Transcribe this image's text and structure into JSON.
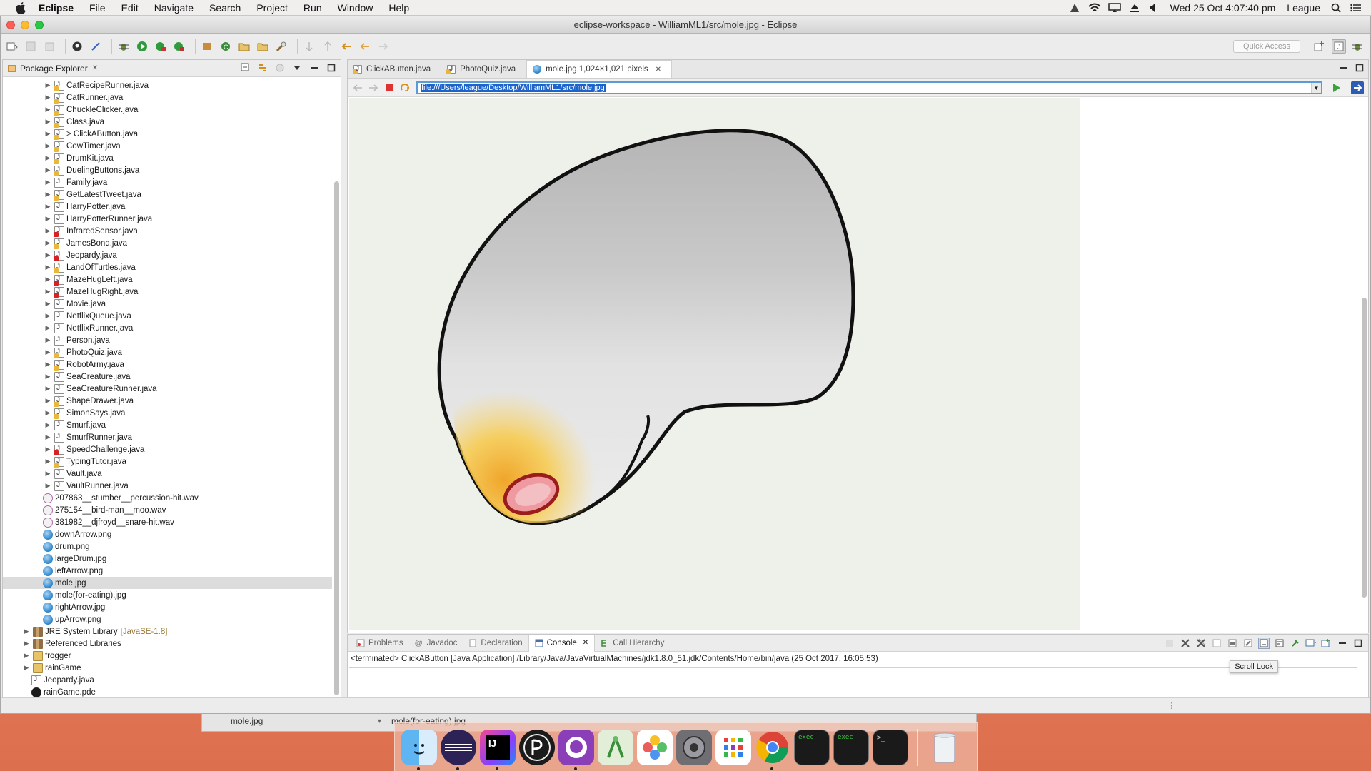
{
  "menubar": {
    "app_name": "Eclipse",
    "menus": [
      "File",
      "Edit",
      "Navigate",
      "Search",
      "Project",
      "Run",
      "Window",
      "Help"
    ],
    "clock": "Wed 25 Oct  4:07:40 pm",
    "user": "League"
  },
  "window": {
    "title": "eclipse-workspace - WilliamML1/src/mole.jpg - Eclipse",
    "quick_access_placeholder": "Quick Access"
  },
  "package_explorer": {
    "title": "Package Explorer",
    "items": [
      {
        "label": "CatRecipeRunner.java",
        "kind": "java",
        "badge": "warn",
        "indent": 1
      },
      {
        "label": "CatRunner.java",
        "kind": "java",
        "badge": "warn",
        "indent": 1
      },
      {
        "label": "ChuckleClicker.java",
        "kind": "java",
        "badge": "warn",
        "indent": 1
      },
      {
        "label": "Class.java",
        "kind": "java",
        "badge": "warn",
        "indent": 1
      },
      {
        "label": "> ClickAButton.java",
        "kind": "java",
        "badge": "warn",
        "indent": 1
      },
      {
        "label": "CowTimer.java",
        "kind": "java",
        "badge": "warn",
        "indent": 1
      },
      {
        "label": "DrumKit.java",
        "kind": "java",
        "badge": "warn",
        "indent": 1
      },
      {
        "label": "DuelingButtons.java",
        "kind": "java",
        "badge": "warn",
        "indent": 1
      },
      {
        "label": "Family.java",
        "kind": "java",
        "badge": "none",
        "indent": 1
      },
      {
        "label": "GetLatestTweet.java",
        "kind": "java",
        "badge": "warn",
        "indent": 1
      },
      {
        "label": "HarryPotter.java",
        "kind": "java",
        "badge": "none",
        "indent": 1
      },
      {
        "label": "HarryPotterRunner.java",
        "kind": "java",
        "badge": "none",
        "indent": 1
      },
      {
        "label": "InfraredSensor.java",
        "kind": "java",
        "badge": "err",
        "indent": 1
      },
      {
        "label": "JamesBond.java",
        "kind": "java",
        "badge": "warn",
        "indent": 1
      },
      {
        "label": "Jeopardy.java",
        "kind": "java",
        "badge": "err",
        "indent": 1
      },
      {
        "label": "LandOfTurtles.java",
        "kind": "java",
        "badge": "warn",
        "indent": 1
      },
      {
        "label": "MazeHugLeft.java",
        "kind": "java",
        "badge": "err",
        "indent": 1
      },
      {
        "label": "MazeHugRight.java",
        "kind": "java",
        "badge": "err",
        "indent": 1
      },
      {
        "label": "Movie.java",
        "kind": "java",
        "badge": "none",
        "indent": 1
      },
      {
        "label": "NetflixQueue.java",
        "kind": "java",
        "badge": "none",
        "indent": 1
      },
      {
        "label": "NetflixRunner.java",
        "kind": "java",
        "badge": "none",
        "indent": 1
      },
      {
        "label": "Person.java",
        "kind": "java",
        "badge": "none",
        "indent": 1
      },
      {
        "label": "PhotoQuiz.java",
        "kind": "java",
        "badge": "warn",
        "indent": 1
      },
      {
        "label": "RobotArmy.java",
        "kind": "java",
        "badge": "warn",
        "indent": 1
      },
      {
        "label": "SeaCreature.java",
        "kind": "java",
        "badge": "none",
        "indent": 1
      },
      {
        "label": "SeaCreatureRunner.java",
        "kind": "java",
        "badge": "none",
        "indent": 1
      },
      {
        "label": "ShapeDrawer.java",
        "kind": "java",
        "badge": "warn",
        "indent": 1
      },
      {
        "label": "SimonSays.java",
        "kind": "java",
        "badge": "warn",
        "indent": 1
      },
      {
        "label": "Smurf.java",
        "kind": "java",
        "badge": "none",
        "indent": 1
      },
      {
        "label": "SmurfRunner.java",
        "kind": "java",
        "badge": "none",
        "indent": 1
      },
      {
        "label": "SpeedChallenge.java",
        "kind": "java",
        "badge": "err",
        "indent": 1
      },
      {
        "label": "TypingTutor.java",
        "kind": "java",
        "badge": "warn",
        "indent": 1
      },
      {
        "label": "Vault.java",
        "kind": "java",
        "badge": "none",
        "indent": 1
      },
      {
        "label": "VaultRunner.java",
        "kind": "java",
        "badge": "none",
        "indent": 1
      },
      {
        "label": "207863__stumber__percussion-hit.wav",
        "kind": "wav",
        "indent": 0
      },
      {
        "label": "275154__bird-man__moo.wav",
        "kind": "wav",
        "indent": 0
      },
      {
        "label": "381982__djfroyd__snare-hit.wav",
        "kind": "wav",
        "indent": 0
      },
      {
        "label": "downArrow.png",
        "kind": "img",
        "indent": 0
      },
      {
        "label": "drum.png",
        "kind": "img",
        "indent": 0
      },
      {
        "label": "largeDrum.jpg",
        "kind": "img",
        "indent": 0
      },
      {
        "label": "leftArrow.png",
        "kind": "img",
        "indent": 0
      },
      {
        "label": "mole.jpg",
        "kind": "img",
        "indent": 0,
        "selected": true
      },
      {
        "label": "mole(for-eating).jpg",
        "kind": "img",
        "indent": 0
      },
      {
        "label": "rightArrow.jpg",
        "kind": "img",
        "indent": 0
      },
      {
        "label": "upArrow.png",
        "kind": "img",
        "indent": 0
      },
      {
        "label": "JRE System Library",
        "suffix": "[JavaSE-1.8]",
        "kind": "lib",
        "indent": -1
      },
      {
        "label": "Referenced Libraries",
        "kind": "lib",
        "indent": -1
      },
      {
        "label": "frogger",
        "kind": "folder",
        "indent": -1
      },
      {
        "label": "rainGame",
        "kind": "folder",
        "indent": -1
      },
      {
        "label": "Jeopardy.java",
        "kind": "javaplain",
        "indent": -2
      },
      {
        "label": "rainGame.pde",
        "kind": "pde",
        "indent": -2
      }
    ]
  },
  "editor": {
    "tabs": [
      {
        "label": "ClickAButton.java",
        "active": false
      },
      {
        "label": "PhotoQuiz.java",
        "active": false
      },
      {
        "label": "mole.jpg 1,024×1,021 pixels",
        "active": true
      }
    ],
    "url": "file:///Users/league/Desktop/WilliamML1/src/mole.jpg"
  },
  "console": {
    "tabs": [
      "Problems",
      "Javadoc",
      "Declaration",
      "Console",
      "Call Hierarchy"
    ],
    "active_tab": "Console",
    "text": "<terminated> ClickAButton [Java Application] /Library/Java/JavaVirtualMachines/jdk1.8.0_51.jdk/Contents/Home/bin/java (25 Oct 2017, 16:05:53)",
    "tooltip": "Scroll Lock"
  },
  "background_window": {
    "cells": [
      "mole.jpg",
      "mole(for-eating).jpg"
    ]
  },
  "dock": {
    "apps": [
      "finder-icon",
      "eclipse-icon",
      "intellij-icon",
      "processing-icon",
      "github-desktop-icon",
      "android-studio-icon",
      "photos-icon",
      "system-preferences-icon",
      "launchpad-icon",
      "chrome-icon",
      "exec-terminal-icon",
      "exec-terminal-icon",
      "terminal-icon",
      "trash-icon"
    ],
    "exec_label": "exec",
    "prompt_label": ">_"
  }
}
